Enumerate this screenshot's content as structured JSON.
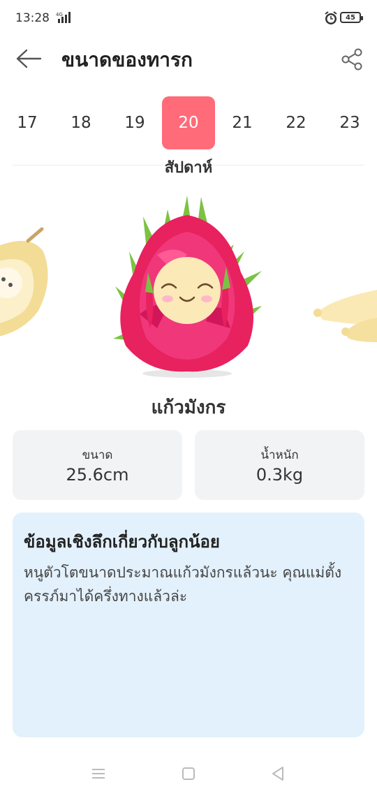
{
  "status_bar": {
    "time": "13:28",
    "network": "4G",
    "battery": "45"
  },
  "header": {
    "title": "ขนาดของทารก",
    "back_icon": "arrow-left-icon",
    "share_icon": "share-icon"
  },
  "weeks": {
    "items": [
      "17",
      "18",
      "19",
      "20",
      "21",
      "22",
      "23"
    ],
    "selected": "20",
    "unit_label": "สัปดาห์"
  },
  "fruit": {
    "name": "แก้วมังกร",
    "image": "dragon-fruit-illustration"
  },
  "stats": {
    "size_label": "ขนาด",
    "size_value": "25.6cm",
    "weight_label": "น้ำหนัก",
    "weight_value": "0.3kg"
  },
  "insight": {
    "title": "ข้อมูลเชิงลึกเกี่ยวกับลูกน้อย",
    "body": "หนูตัวโตขนาดประมาณแก้วมังกรแล้วนะ คุณแม่ตั้งครรภ์มาได้ครึ่งทางแล้วล่ะ"
  },
  "colors": {
    "accent": "#ff6b78",
    "card_bg": "#f2f3f5",
    "insight_bg": "#e3f1fc"
  }
}
